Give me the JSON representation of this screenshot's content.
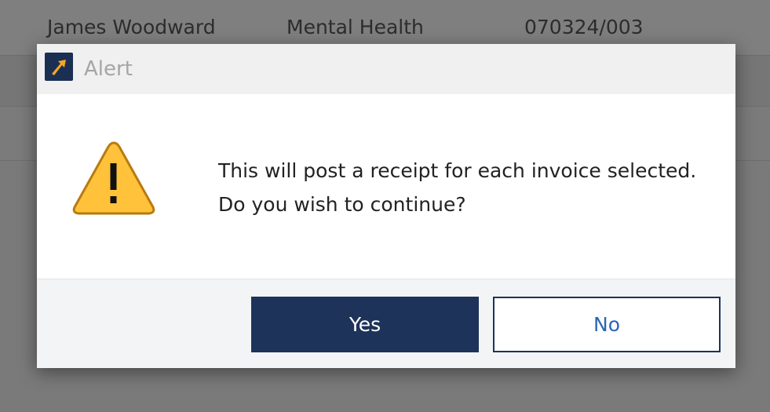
{
  "background_table": {
    "rows": [
      {
        "name": "James Woodward",
        "department": "Mental Health",
        "reference": "070324/003"
      }
    ]
  },
  "dialog": {
    "title": "Alert",
    "icon": "warning-icon",
    "message_lines": [
      "This will post a receipt for each invoice selected.",
      "Do you wish to continue?"
    ],
    "buttons": {
      "yes_label": "Yes",
      "no_label": "No"
    }
  },
  "colors": {
    "primary": "#1e3359",
    "link_text": "#2a66b3",
    "warning_fill": "#ffc23a",
    "logo_accent": "#f5a623"
  }
}
